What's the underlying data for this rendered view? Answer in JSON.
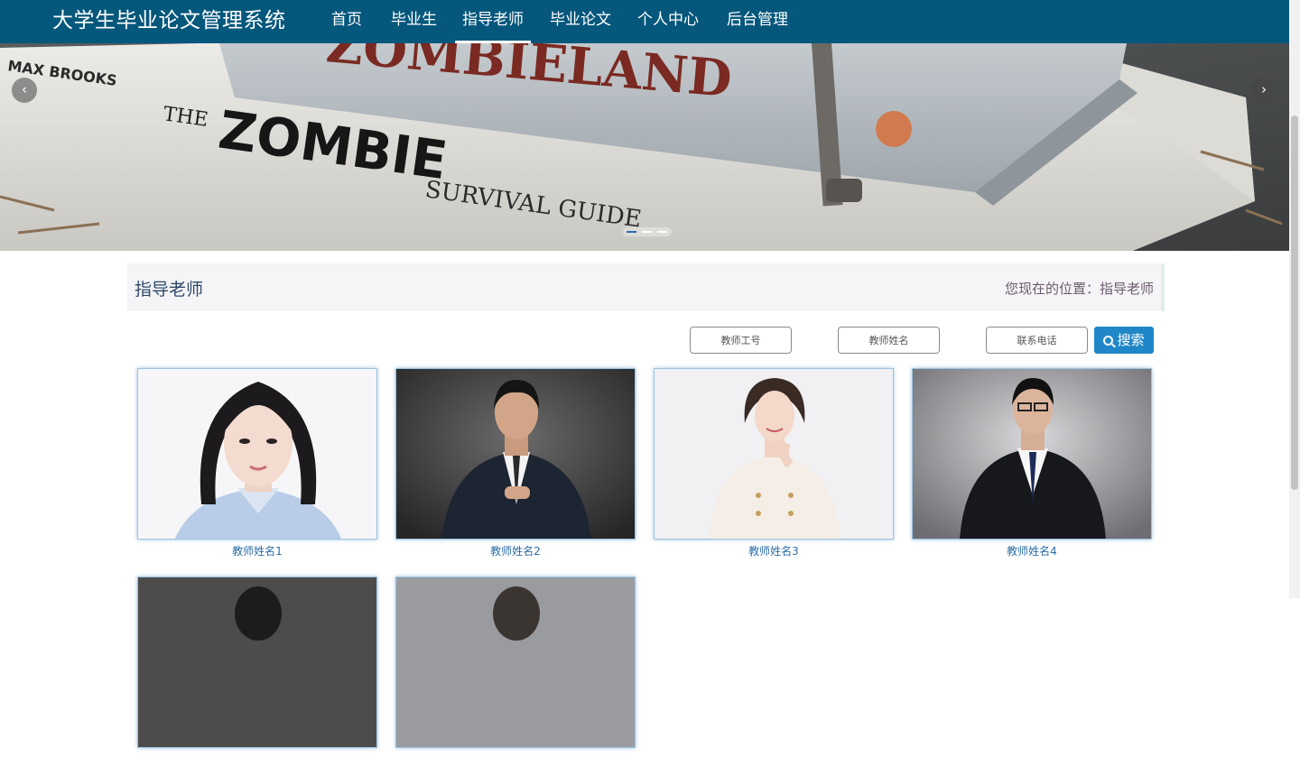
{
  "header": {
    "site_title": "大学生毕业论文管理系统",
    "nav": [
      {
        "label": "首页",
        "active": false
      },
      {
        "label": "毕业生",
        "active": false
      },
      {
        "label": "指导老师",
        "active": true
      },
      {
        "label": "毕业论文",
        "active": false
      },
      {
        "label": "个人中心",
        "active": false
      },
      {
        "label": "后台管理",
        "active": false
      }
    ]
  },
  "banner": {
    "prev_icon": "chevron-left-icon",
    "next_icon": "chevron-right-icon",
    "prev_glyph": "‹",
    "next_glyph": "›",
    "book_texts": [
      "MAX BROOKS",
      "THE",
      "ZOMBIE",
      "SURVIVAL GUIDE",
      "ZOMBIELAND"
    ],
    "indicator_count": 3,
    "active_indicator": 0
  },
  "section": {
    "title": "指导老师",
    "breadcrumb": "您现在的位置：指导老师"
  },
  "search": {
    "fields": [
      {
        "placeholder": "教师工号"
      },
      {
        "placeholder": "教师姓名"
      },
      {
        "placeholder": "联系电话"
      }
    ],
    "button_label": "搜索",
    "button_icon": "search-icon"
  },
  "teachers": [
    {
      "name": "教师姓名1"
    },
    {
      "name": "教师姓名2"
    },
    {
      "name": "教师姓名3"
    },
    {
      "name": "教师姓名4"
    },
    {
      "name": ""
    },
    {
      "name": ""
    }
  ],
  "colors": {
    "nav_bg": "#05577c",
    "accent": "#1f87c7",
    "name_text": "#2c6da6",
    "section_title": "#2e4a68"
  }
}
